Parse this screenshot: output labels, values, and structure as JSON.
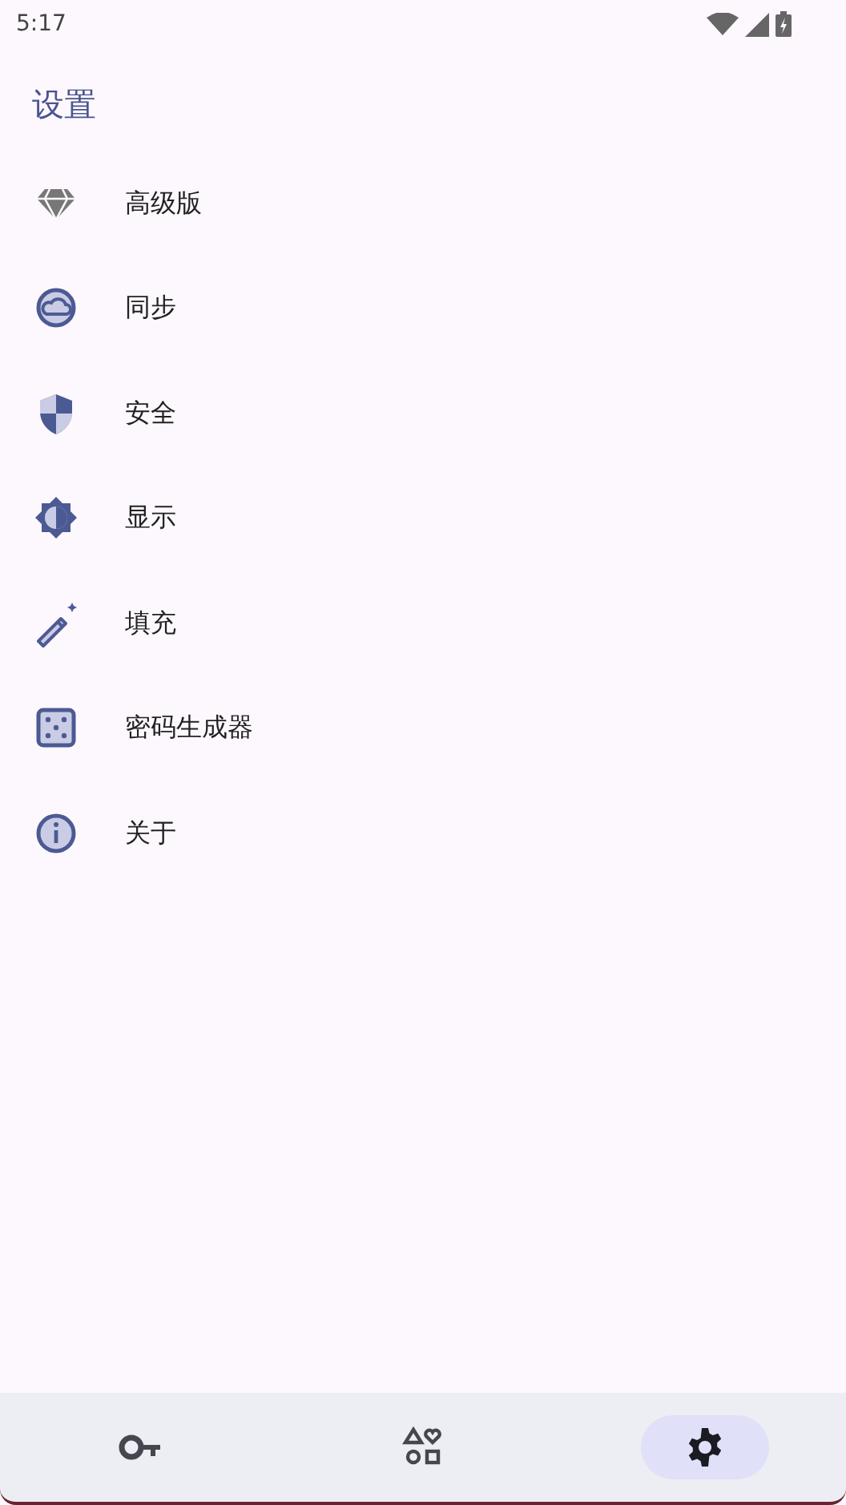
{
  "status_bar": {
    "time": "5:17"
  },
  "title": "设置",
  "items": [
    {
      "kind": "diamond",
      "label": "高级版"
    },
    {
      "kind": "cloud",
      "label": "同步"
    },
    {
      "kind": "shield",
      "label": "安全"
    },
    {
      "kind": "brightness",
      "label": "显示"
    },
    {
      "kind": "wand",
      "label": "填充"
    },
    {
      "kind": "dice",
      "label": "密码生成器"
    },
    {
      "kind": "info",
      "label": "关于"
    }
  ],
  "bottom_nav": [
    {
      "kind": "key",
      "selected": false
    },
    {
      "kind": "shapes",
      "selected": false
    },
    {
      "kind": "gear",
      "selected": true
    }
  ]
}
